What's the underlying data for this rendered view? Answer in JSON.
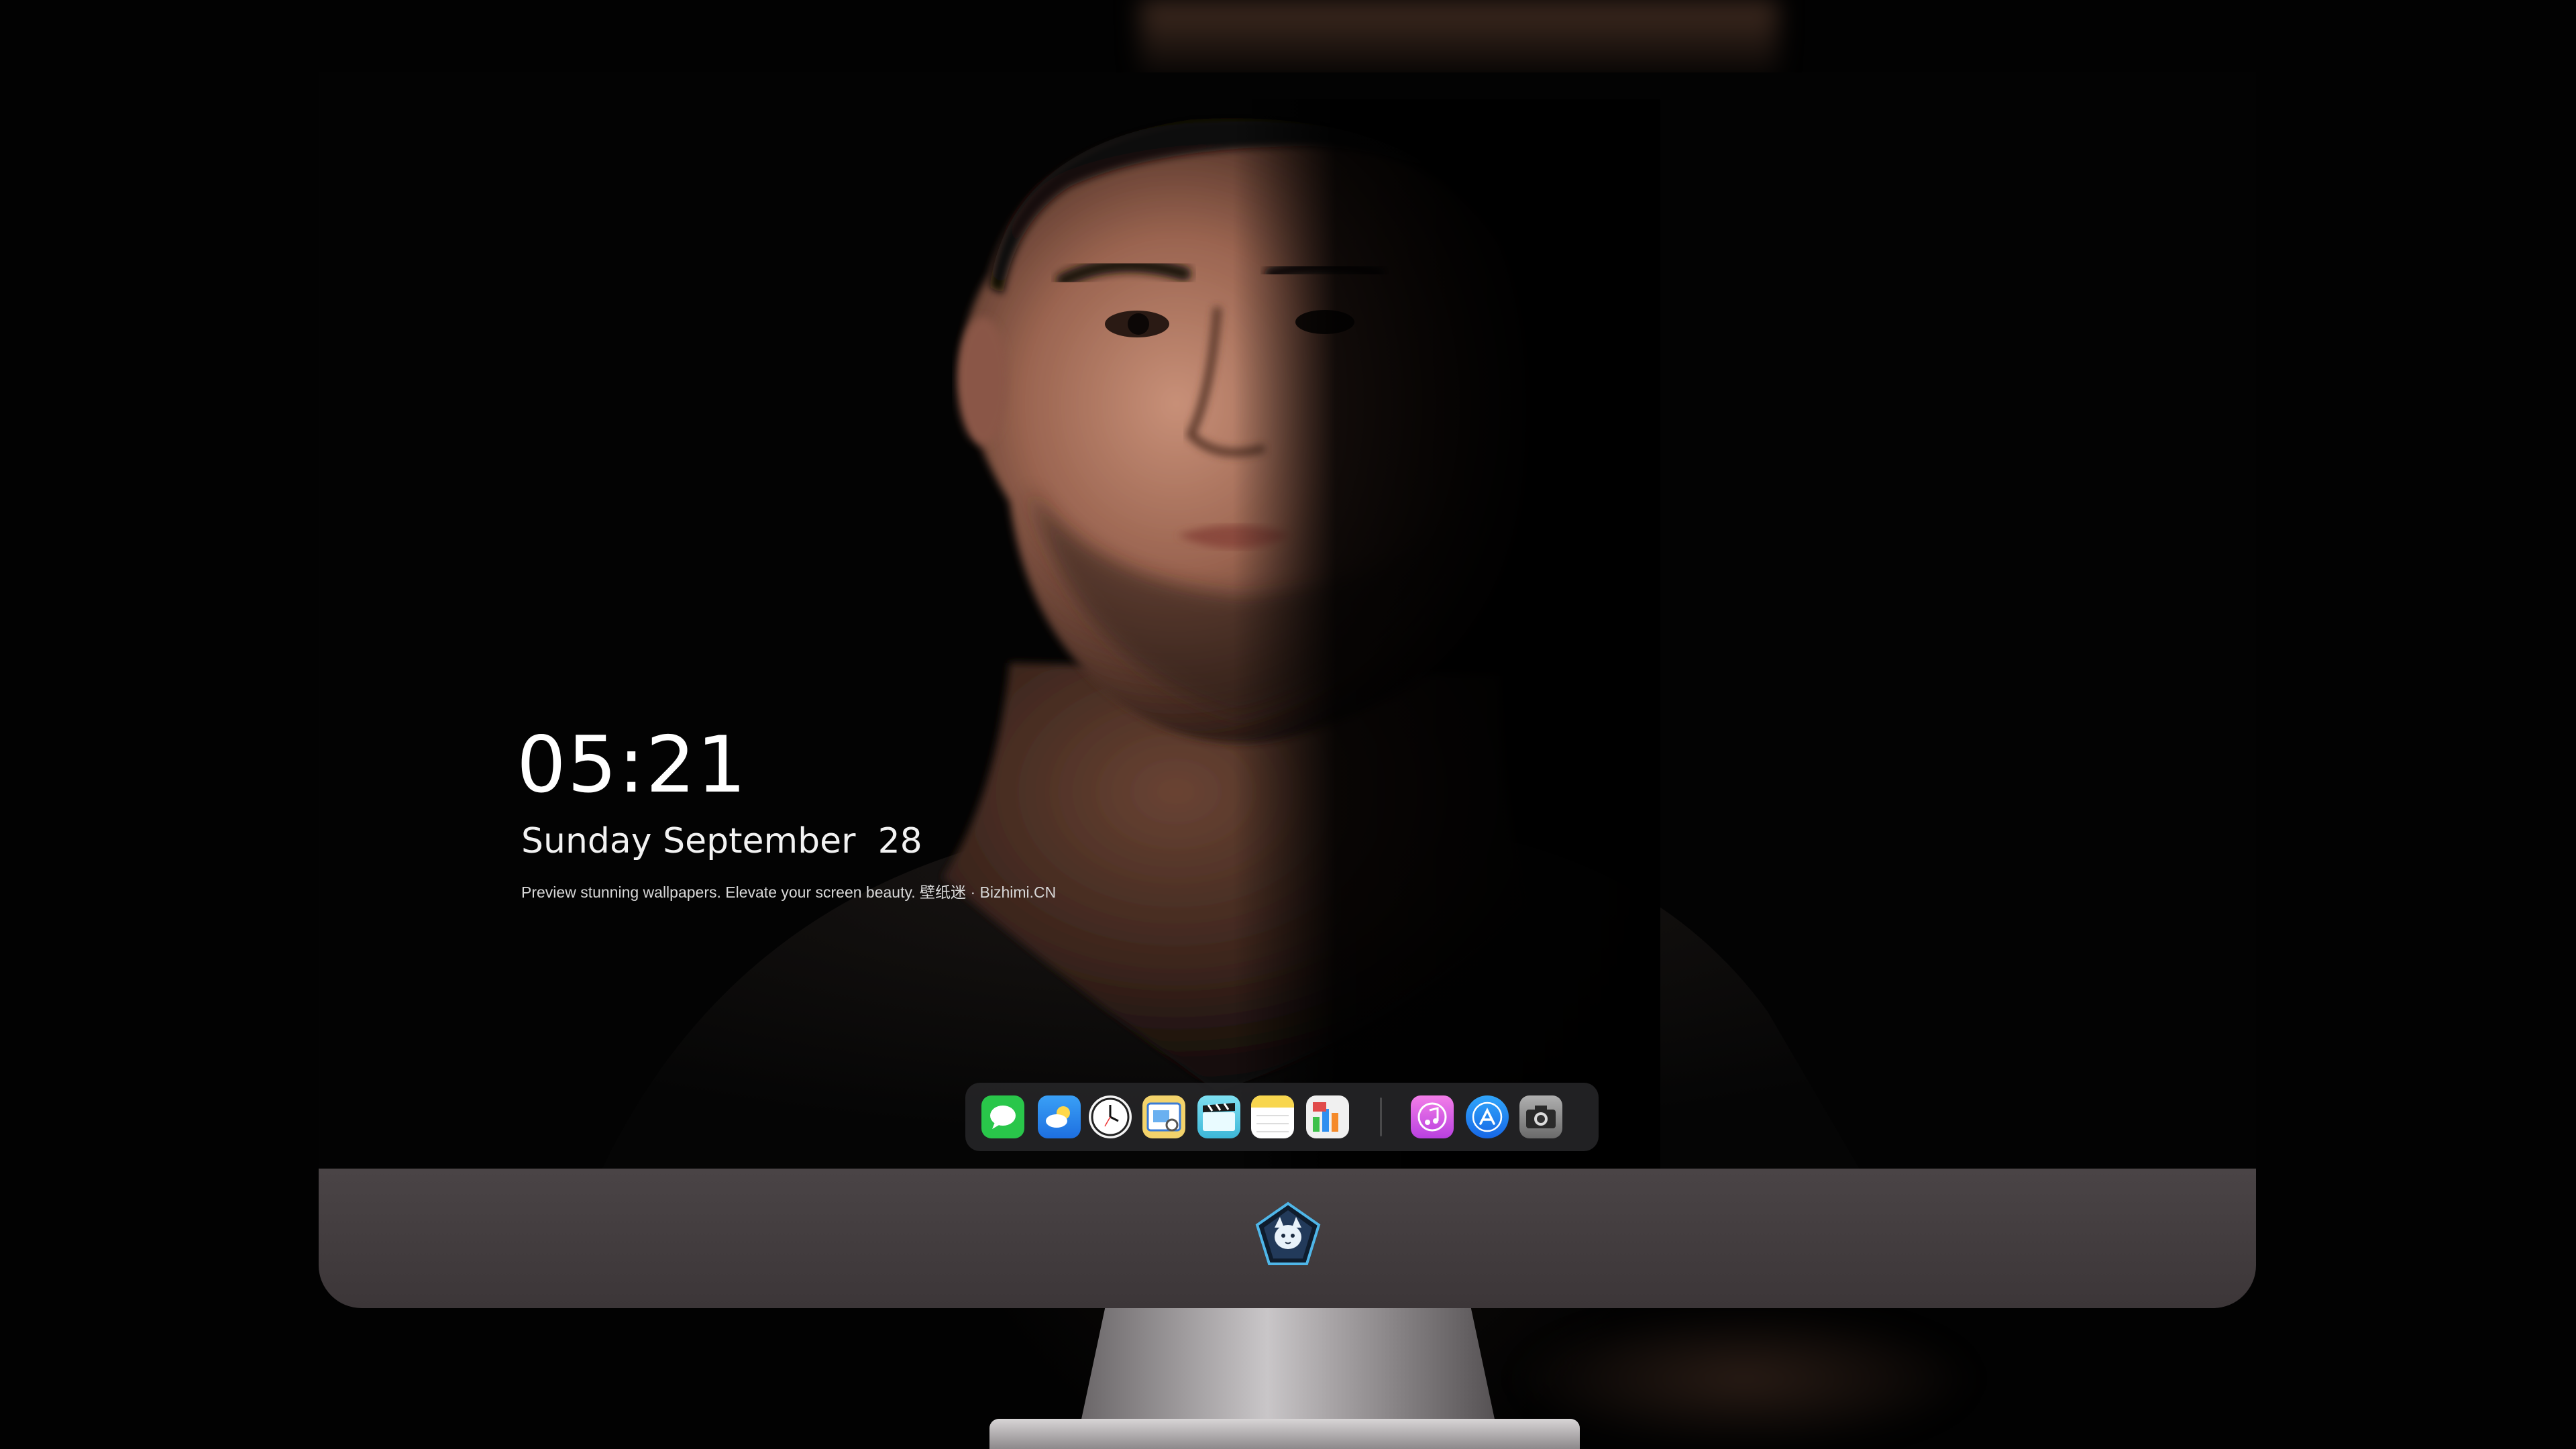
{
  "lockscreen": {
    "time": "05:21",
    "date": "Sunday September  28",
    "tagline": "Preview stunning wallpapers. Elevate your screen beauty. 壁纸迷 · Bizhimi.CN"
  },
  "dock": {
    "items": [
      {
        "name": "messages-icon",
        "color": "#29c64a"
      },
      {
        "name": "weather-icon",
        "color": "#2f8ff0"
      },
      {
        "name": "clock-icon",
        "color": "#f4f4f4"
      },
      {
        "name": "preview-icon",
        "color": "#f3d36b"
      },
      {
        "name": "clips-icon",
        "color": "#5fd0e8"
      },
      {
        "name": "notes-icon",
        "color": "#f8d64e"
      },
      {
        "name": "numbers-icon",
        "color": "#f0f0f0"
      },
      {
        "name": "itunes-icon",
        "color": "#e45be0"
      },
      {
        "name": "app-store-icon",
        "color": "#1f8cf5"
      },
      {
        "name": "camera-icon",
        "color": "#9a9a9a"
      }
    ]
  },
  "monitor": {
    "chin_logo": "fox-mascot-logo"
  }
}
